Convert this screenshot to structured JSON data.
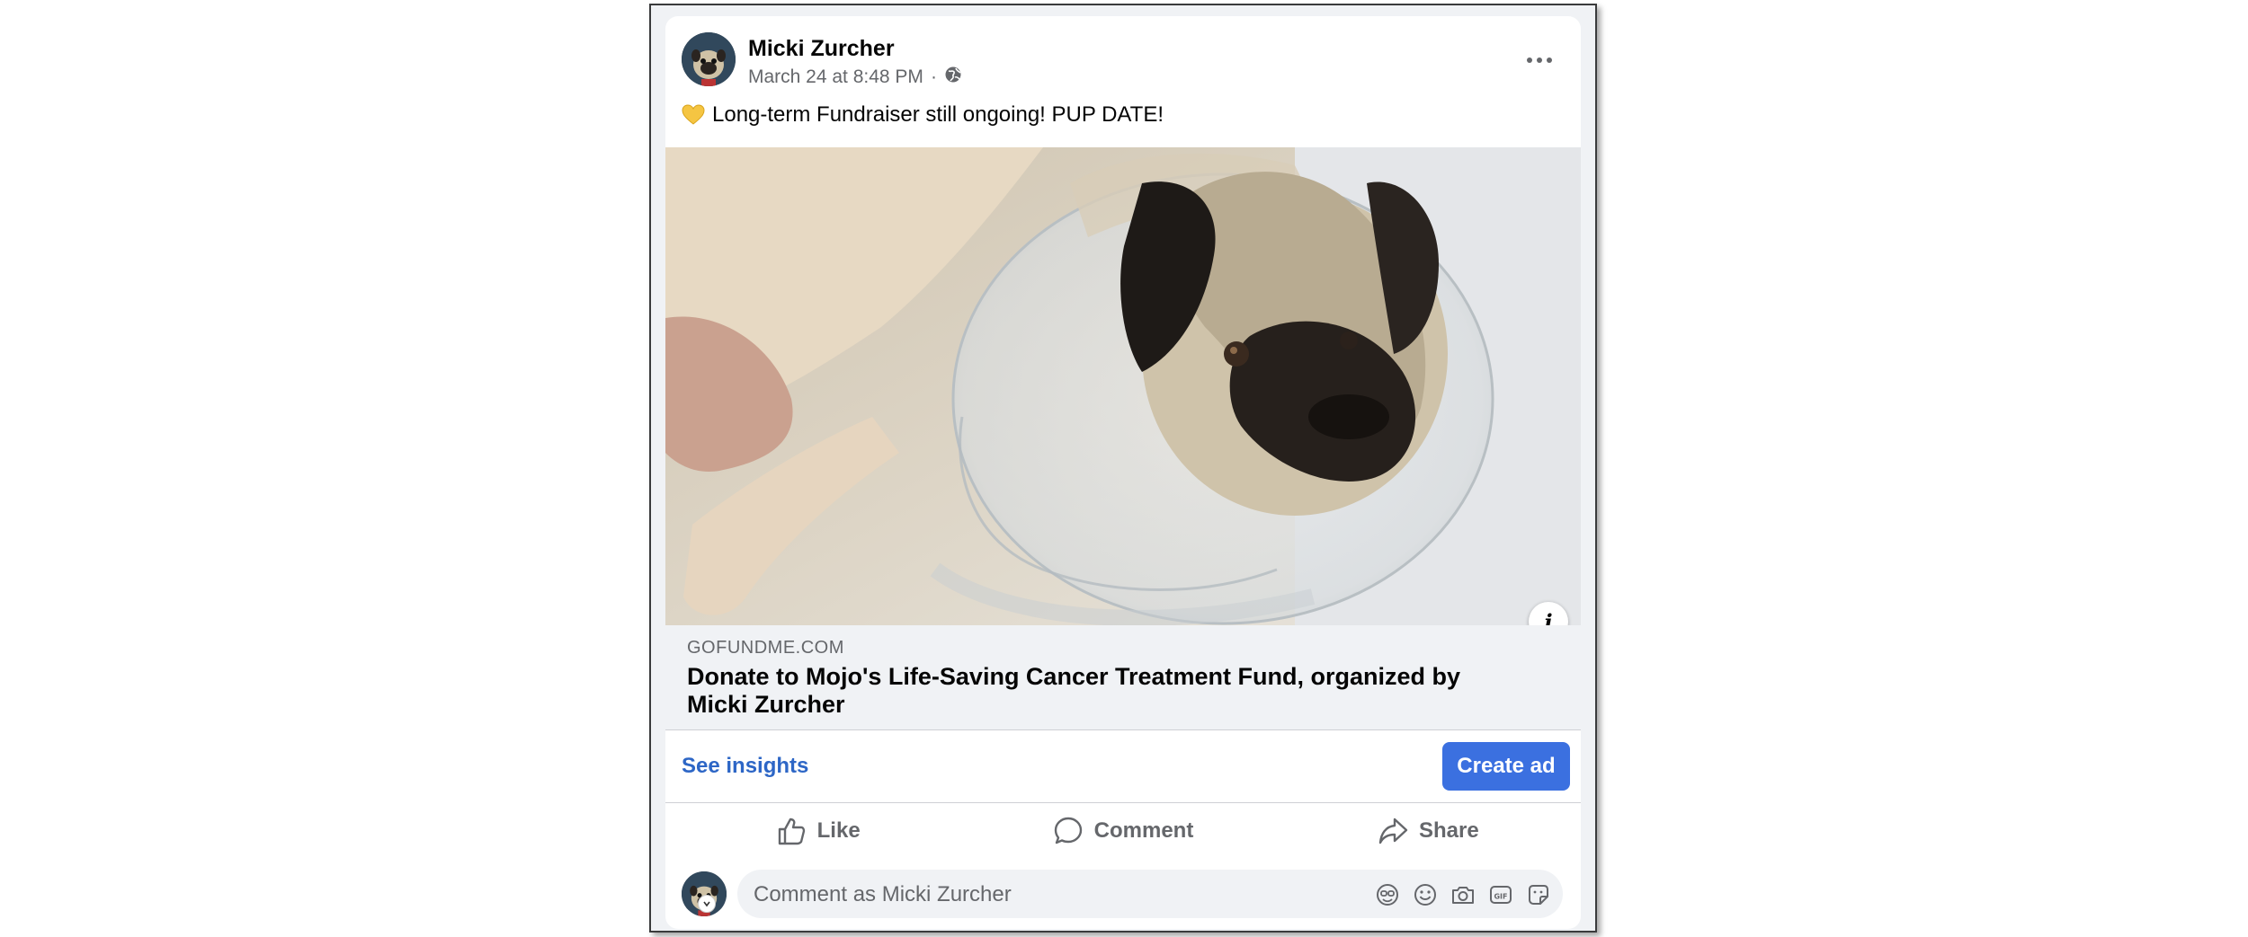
{
  "post": {
    "author": "Micki Zurcher",
    "timestamp": "March 24 at 8:48 PM",
    "separator": "·",
    "privacy_icon": "globe-icon",
    "text": "Long-term Fundraiser still ongoing! PUP DATE!",
    "emoji_icon": "yellow-heart-icon"
  },
  "link_preview": {
    "domain": "GOFUNDME.COM",
    "title": "Donate to Mojo's Life-Saving Cancer Treatment Fund, organized by Micki Zurcher",
    "info_label": "i"
  },
  "insights": {
    "see_insights_label": "See insights",
    "create_ad_label": "Create ad"
  },
  "actions": {
    "like_label": "Like",
    "comment_label": "Comment",
    "share_label": "Share"
  },
  "comment_box": {
    "placeholder": "Comment as Micki Zurcher",
    "icons": [
      "avatar-sticker-icon",
      "emoji-icon",
      "camera-icon",
      "gif-icon",
      "sticker-icon"
    ]
  },
  "colors": {
    "accent_blue": "#3b70e0",
    "link_blue": "#2d66c6",
    "secondary_text": "#65676b",
    "link_box_bg": "#f0f2f5"
  }
}
